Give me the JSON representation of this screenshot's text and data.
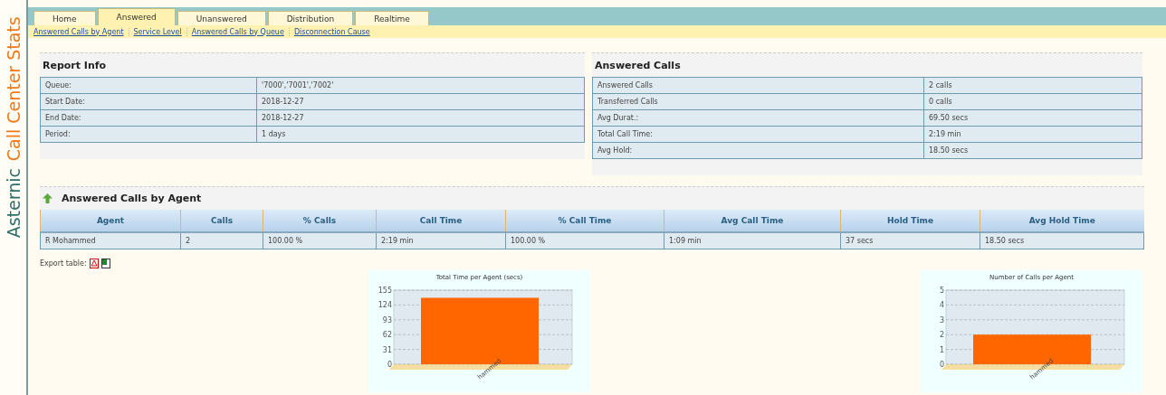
{
  "brand": {
    "first": "Asternic",
    "second": "Call Center Stats"
  },
  "tabs": [
    {
      "label": "Home",
      "selected": false
    },
    {
      "label": "Answered",
      "selected": true
    },
    {
      "label": "Unanswered",
      "selected": false
    },
    {
      "label": "Distribution",
      "selected": false
    },
    {
      "label": "Realtime",
      "selected": false
    }
  ],
  "subnav": [
    "Answered Calls by Agent",
    "Service Level",
    "Answered Calls by Queue",
    "Disconnection Cause"
  ],
  "report_info": {
    "title": "Report Info",
    "rows": [
      [
        "Queue:",
        "'7000','7001','7002'"
      ],
      [
        "Start Date:",
        "2018-12-27"
      ],
      [
        "End Date:",
        "2018-12-27"
      ],
      [
        "Period:",
        "1 days"
      ]
    ]
  },
  "answered_calls": {
    "title": "Answered Calls",
    "rows": [
      [
        "Answered Calls",
        "2 calls"
      ],
      [
        "Transferred Calls",
        "0 calls"
      ],
      [
        "Avg Durat.:",
        "69.50 secs"
      ],
      [
        "Total Call Time:",
        "2:19 min"
      ],
      [
        "Avg Hold:",
        "18.50 secs"
      ]
    ]
  },
  "agent_section": {
    "title": "Answered Calls by Agent",
    "columns": [
      "Agent",
      "Calls",
      "% Calls",
      "Call Time",
      "% Call Time",
      "Avg Call Time",
      "Hold Time",
      "Avg Hold Time"
    ],
    "rows": [
      [
        "R Mohammed",
        "2",
        "100.00 %",
        "2:19 min",
        "100.00 %",
        "1:09 min",
        "37 secs",
        "18.50 secs"
      ]
    ],
    "export_label": "Export table:"
  },
  "charts": [
    {
      "chart_data": {
        "type": "bar",
        "title": "Total Time per Agent (secs)",
        "categories": [
          "hammed"
        ],
        "series": [
          {
            "color": "#ff6600",
            "values": [
              139
            ]
          }
        ],
        "grid": true,
        "ylim": [
          0,
          155
        ],
        "yticks": [
          0,
          31,
          62,
          93,
          124,
          155
        ]
      }
    },
    {
      "chart_data": {
        "type": "bar",
        "title": "Number of Calls per Agent",
        "categories": [
          "hammed"
        ],
        "series": [
          {
            "color": "#ff6600",
            "values": [
              2
            ]
          }
        ],
        "grid": true,
        "ylim": [
          0,
          5
        ],
        "yticks": [
          0,
          1,
          2,
          3,
          4,
          5
        ]
      }
    }
  ]
}
